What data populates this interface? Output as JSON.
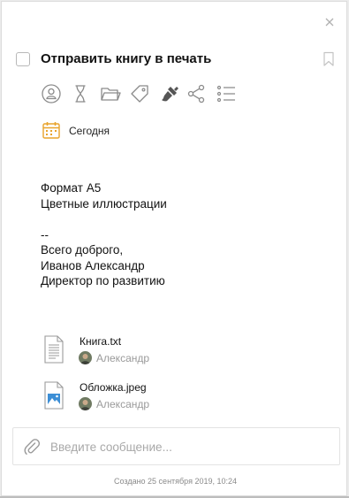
{
  "task": {
    "title": "Отправить книгу в печать",
    "date_label": "Сегодня",
    "description_lines": [
      "Формат А5",
      "Цветные иллюстрации",
      "",
      "--",
      "Всего доброго,",
      "Иванов Александр",
      "Директор по развитию"
    ]
  },
  "toolbar": {
    "icons": [
      "assignee-icon",
      "hourglass-icon",
      "folder-icon",
      "tag-icon",
      "brush-icon",
      "share-icon",
      "checklist-icon"
    ]
  },
  "attachments": [
    {
      "name": "Книга.txt",
      "author": "Александр",
      "type": "text-file-icon"
    },
    {
      "name": "Обложка.jpeg",
      "author": "Александр",
      "type": "image-file-icon"
    }
  ],
  "composer": {
    "placeholder": "Введите сообщение..."
  },
  "footer": {
    "created": "Создано 25 сентября 2019, 10:24"
  },
  "colors": {
    "icon": "#8a8a8a",
    "calendar": "#e8a32c",
    "image_file": "#3d8fd6"
  }
}
